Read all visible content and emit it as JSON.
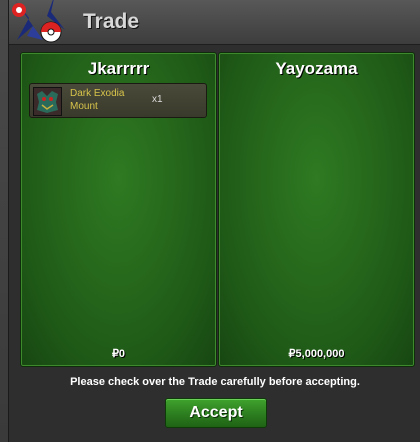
{
  "window": {
    "title": "Trade"
  },
  "left_panel": {
    "player_name": "Jkarrrrr",
    "money": "₽0",
    "items": [
      {
        "name": "Dark Exodia Mount",
        "quantity": "x1"
      }
    ]
  },
  "right_panel": {
    "player_name": "Yayozama",
    "money": "₽5,000,000",
    "items": []
  },
  "footer": {
    "notice": "Please check over the Trade carefully before accepting.",
    "accept_label": "Accept"
  },
  "colors": {
    "panel_green": "#2f7a22",
    "button_green": "#2c7d1f",
    "item_text": "#d7c44a"
  }
}
